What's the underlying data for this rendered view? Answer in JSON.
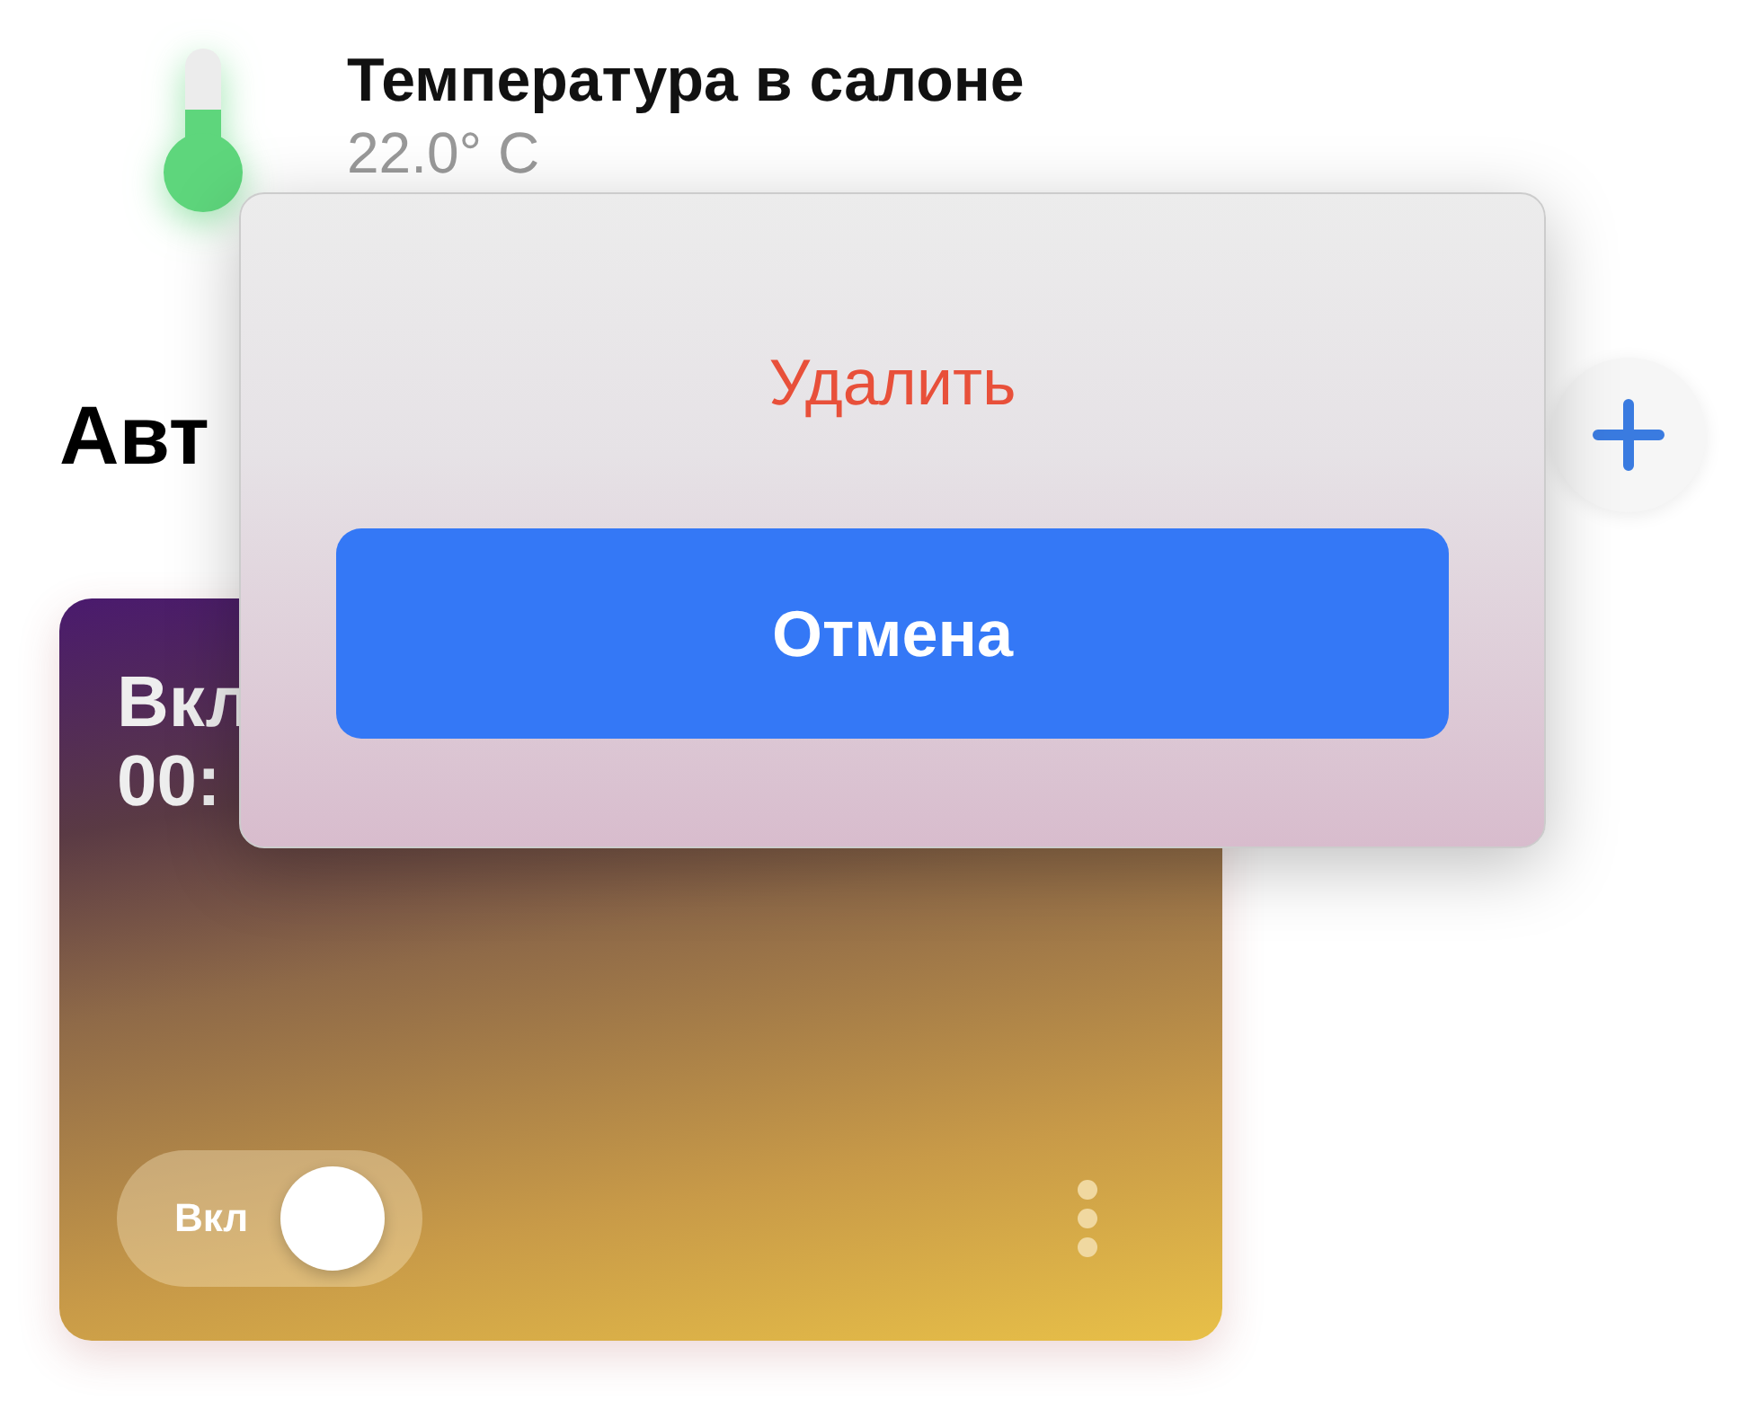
{
  "sensor": {
    "name": "Температура в салоне",
    "value": "22.0° C"
  },
  "section": {
    "title": "Авт"
  },
  "automation": {
    "title": "Вкл",
    "time": "00:",
    "toggle": {
      "label": "Вкл",
      "on": true
    }
  },
  "dialog": {
    "actions": [
      {
        "label": "Удалить",
        "kind": "destructive"
      },
      {
        "label": "Отмена",
        "kind": "cancel"
      }
    ]
  }
}
